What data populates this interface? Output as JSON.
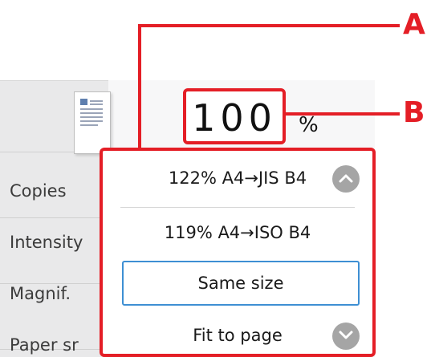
{
  "settings_list": {
    "items": [
      "Copies",
      "Intensity",
      "Magnif.",
      "Paper sr"
    ]
  },
  "magnification": {
    "value": "100",
    "unit": "%"
  },
  "options": {
    "items": [
      {
        "label": "122% A4→JIS B4"
      },
      {
        "label": "119% A4→ISO B4"
      },
      {
        "label": "Same size",
        "selected": true
      },
      {
        "label": "Fit to page"
      }
    ]
  },
  "callouts": {
    "a": "A",
    "b": "B",
    "color": "#e41e26"
  },
  "icons": {
    "scroll_up": "chevron-up-icon",
    "scroll_down": "chevron-down-icon",
    "preview": "document-preview-icon"
  },
  "colors": {
    "selection_border": "#3e8fd3",
    "scroll_button": "#a5a5a5",
    "list_background": "#e9e9ea"
  }
}
